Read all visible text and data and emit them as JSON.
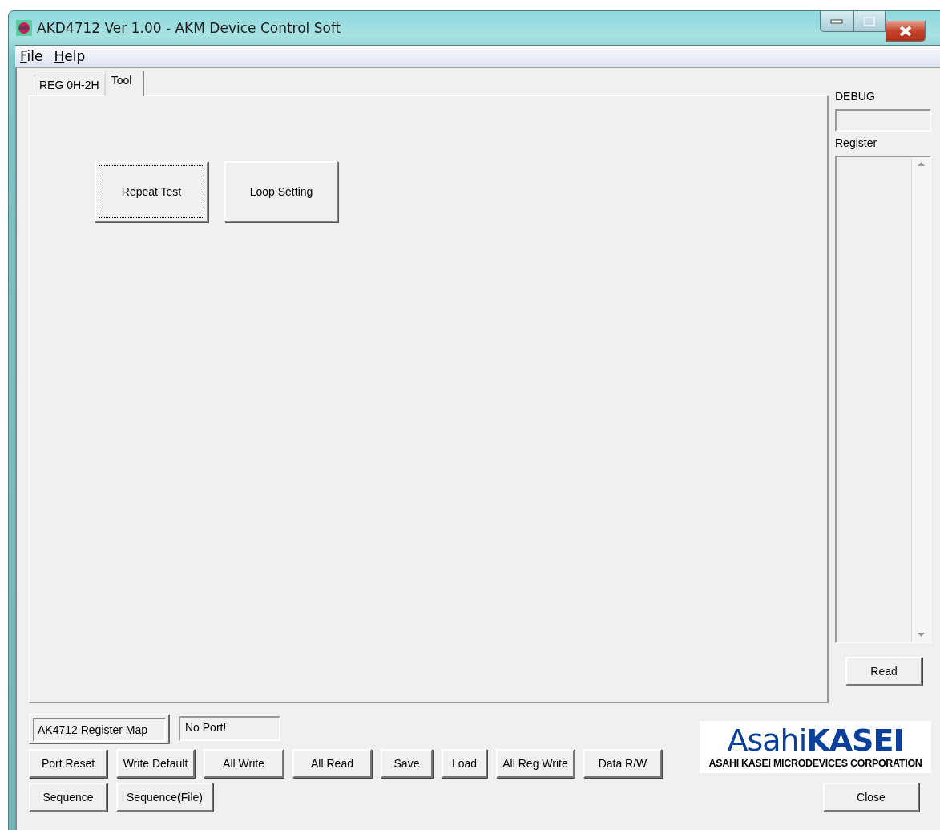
{
  "window": {
    "title": "AKD4712 Ver 1.00 - AKM Device Control Soft"
  },
  "menu": [
    {
      "label": "File"
    },
    {
      "label": "Help"
    }
  ],
  "tabs": [
    {
      "label": "REG 0H-2H",
      "selected": false
    },
    {
      "label": "Tool",
      "selected": true
    }
  ],
  "tool_buttons": [
    {
      "label": "Repeat Test",
      "focused": true
    },
    {
      "label": "Loop Setting",
      "focused": false
    }
  ],
  "debug": {
    "label": "DEBUG"
  },
  "register": {
    "label": "Register"
  },
  "read_button": "Read",
  "register_map_button": "AK4712 Register Map",
  "port_status": "No Port!",
  "button_rows": [
    [
      "Port Reset",
      "Write Default",
      "All Write",
      "All Read",
      "Save",
      "Load",
      "All Reg Write",
      "Data R/W"
    ],
    [
      "Sequence",
      "Sequence(File)"
    ]
  ],
  "logo": {
    "name": "Asahi**KASEI**",
    "tagline": "ASAHI KASEI MICRODEVICES CORPORATION"
  },
  "close_button": "Close"
}
